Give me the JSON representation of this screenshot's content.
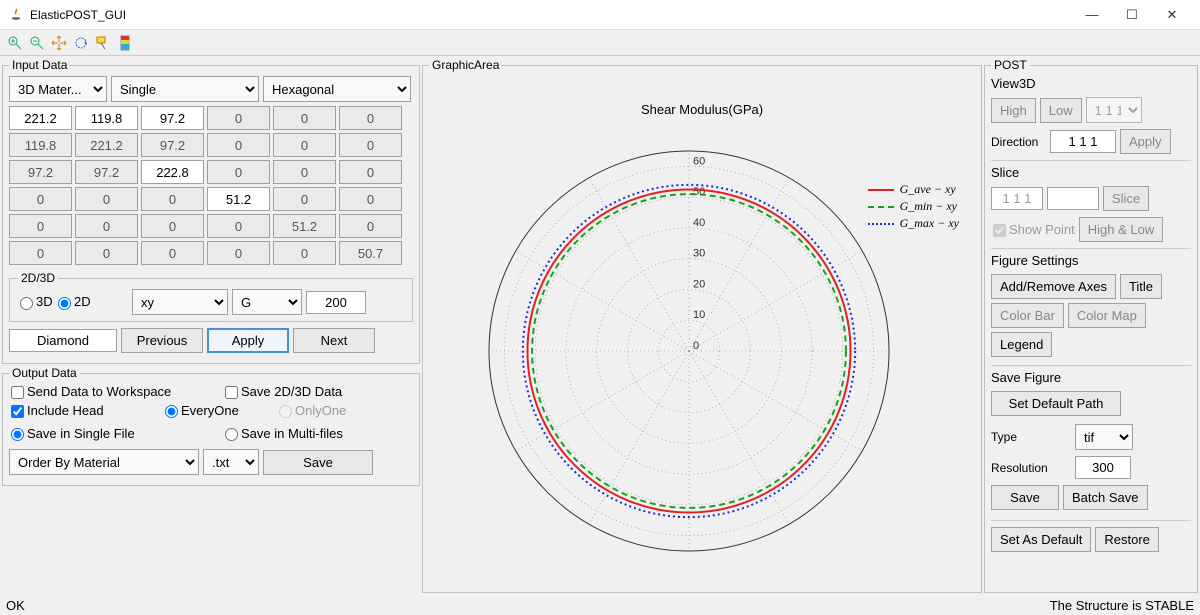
{
  "window": {
    "title": "ElasticPOST_GUI"
  },
  "input_panel": {
    "legend": "Input Data",
    "material_type": "3D Mater...",
    "single": "Single",
    "crystal": "Hexagonal",
    "matrix": [
      [
        "221.2",
        "119.8",
        "97.2",
        "0",
        "0",
        "0"
      ],
      [
        "119.8",
        "221.2",
        "97.2",
        "0",
        "0",
        "0"
      ],
      [
        "97.2",
        "97.2",
        "222.8",
        "0",
        "0",
        "0"
      ],
      [
        "0",
        "0",
        "0",
        "51.2",
        "0",
        "0"
      ],
      [
        "0",
        "0",
        "0",
        "0",
        "51.2",
        "0"
      ],
      [
        "0",
        "0",
        "0",
        "0",
        "0",
        "50.7"
      ]
    ],
    "editable_mask": [
      [
        1,
        1,
        1,
        0,
        0,
        0
      ],
      [
        0,
        0,
        0,
        0,
        0,
        0
      ],
      [
        0,
        0,
        1,
        0,
        0,
        0
      ],
      [
        0,
        0,
        0,
        1,
        0,
        0
      ],
      [
        0,
        0,
        0,
        0,
        0,
        0
      ],
      [
        0,
        0,
        0,
        0,
        0,
        0
      ]
    ],
    "dim_label": "2D/3D",
    "dim_3d": "3D",
    "dim_2d": "2D",
    "plane": "xy",
    "property": "G",
    "npoints": "200",
    "material_name": "Diamond",
    "btn_prev": "Previous",
    "btn_apply": "Apply",
    "btn_next": "Next"
  },
  "output_panel": {
    "legend": "Output Data",
    "send_ws": "Send Data to Workspace",
    "save_data": "Save 2D/3D Data",
    "include_head": "Include Head",
    "everyone": "EveryOne",
    "onlyone": "OnlyOne",
    "single_file": "Save in Single File",
    "multi_file": "Save in Multi-files",
    "order_by": "Order By Material",
    "ext": ".txt",
    "save_btn": "Save"
  },
  "graphic": {
    "legend": "GraphicArea",
    "title": "Shear Modulus(GPa)",
    "legend_items": [
      "G_ave − xy",
      "G_min − xy",
      "G_max − xy"
    ],
    "colors": {
      "ave": "#e22222",
      "min": "#18a018",
      "max": "#1a2bd6"
    }
  },
  "post": {
    "legend": "POST",
    "view3d": "View3D",
    "high": "High",
    "low": "Low",
    "miller": "1 1 1",
    "direction_label": "Direction",
    "direction": "1 1 1",
    "apply": "Apply",
    "slice_label": "Slice",
    "slice_val": "1 1 1",
    "slice_btn": "Slice",
    "show_point": "Show Point",
    "high_low": "High & Low",
    "fig_settings": "Figure Settings",
    "axes": "Add/Remove Axes",
    "title_btn": "Title",
    "colorbar": "Color Bar",
    "colormap": "Color Map",
    "legend_btn": "Legend",
    "save_fig": "Save Figure",
    "set_path": "Set Default Path",
    "type_label": "Type",
    "type_val": "tif",
    "res_label": "Resolution",
    "res_val": "300",
    "save": "Save",
    "batch": "Batch Save",
    "set_default": "Set As Default",
    "restore": "Restore"
  },
  "status": {
    "left": "OK",
    "right": "The Structure is STABLE"
  },
  "chart_data": {
    "type": "polar-line",
    "title": "Shear Modulus(GPa)",
    "radial_ticks": [
      0,
      10,
      20,
      30,
      40,
      50,
      60
    ],
    "rlim": [
      0,
      65
    ],
    "series": [
      {
        "name": "G_ave − xy",
        "style": "solid",
        "color": "#e22222",
        "radius": 52.5
      },
      {
        "name": "G_min − xy",
        "style": "dash",
        "color": "#18a018",
        "radius": 51.0
      },
      {
        "name": "G_max − xy",
        "style": "dot",
        "color": "#1a2bd6",
        "radius": 54.0
      }
    ],
    "angular_ticks_deg_step": 30,
    "plane": "xy"
  }
}
